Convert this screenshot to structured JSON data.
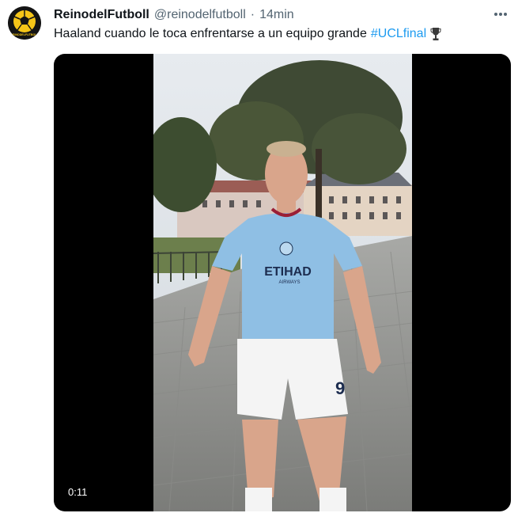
{
  "tweet": {
    "author": {
      "display_name": "ReinodelFutboll",
      "handle": "@reinodelfutboll",
      "avatar_text": "REINODELFUTBOLL"
    },
    "separator": "·",
    "timestamp": "14min",
    "more_icon": "more-horizontal-icon",
    "text": "Haaland cuando le toca enfrentarse a un equipo grande",
    "hashtag": "#UCLfinal",
    "trophy_icon": "trophy-icon",
    "media": {
      "type": "video",
      "duration": "0:11",
      "shirt_sponsor": "ETIHAD",
      "shirt_sponsor_sub": "AIRWAYS",
      "shorts_number": "9"
    }
  },
  "colors": {
    "accent": "#1d9bf0",
    "secondary_text": "#536471",
    "primary_text": "#0f1419",
    "avatar_bg": "#141414",
    "avatar_ball": "#f5c518"
  }
}
